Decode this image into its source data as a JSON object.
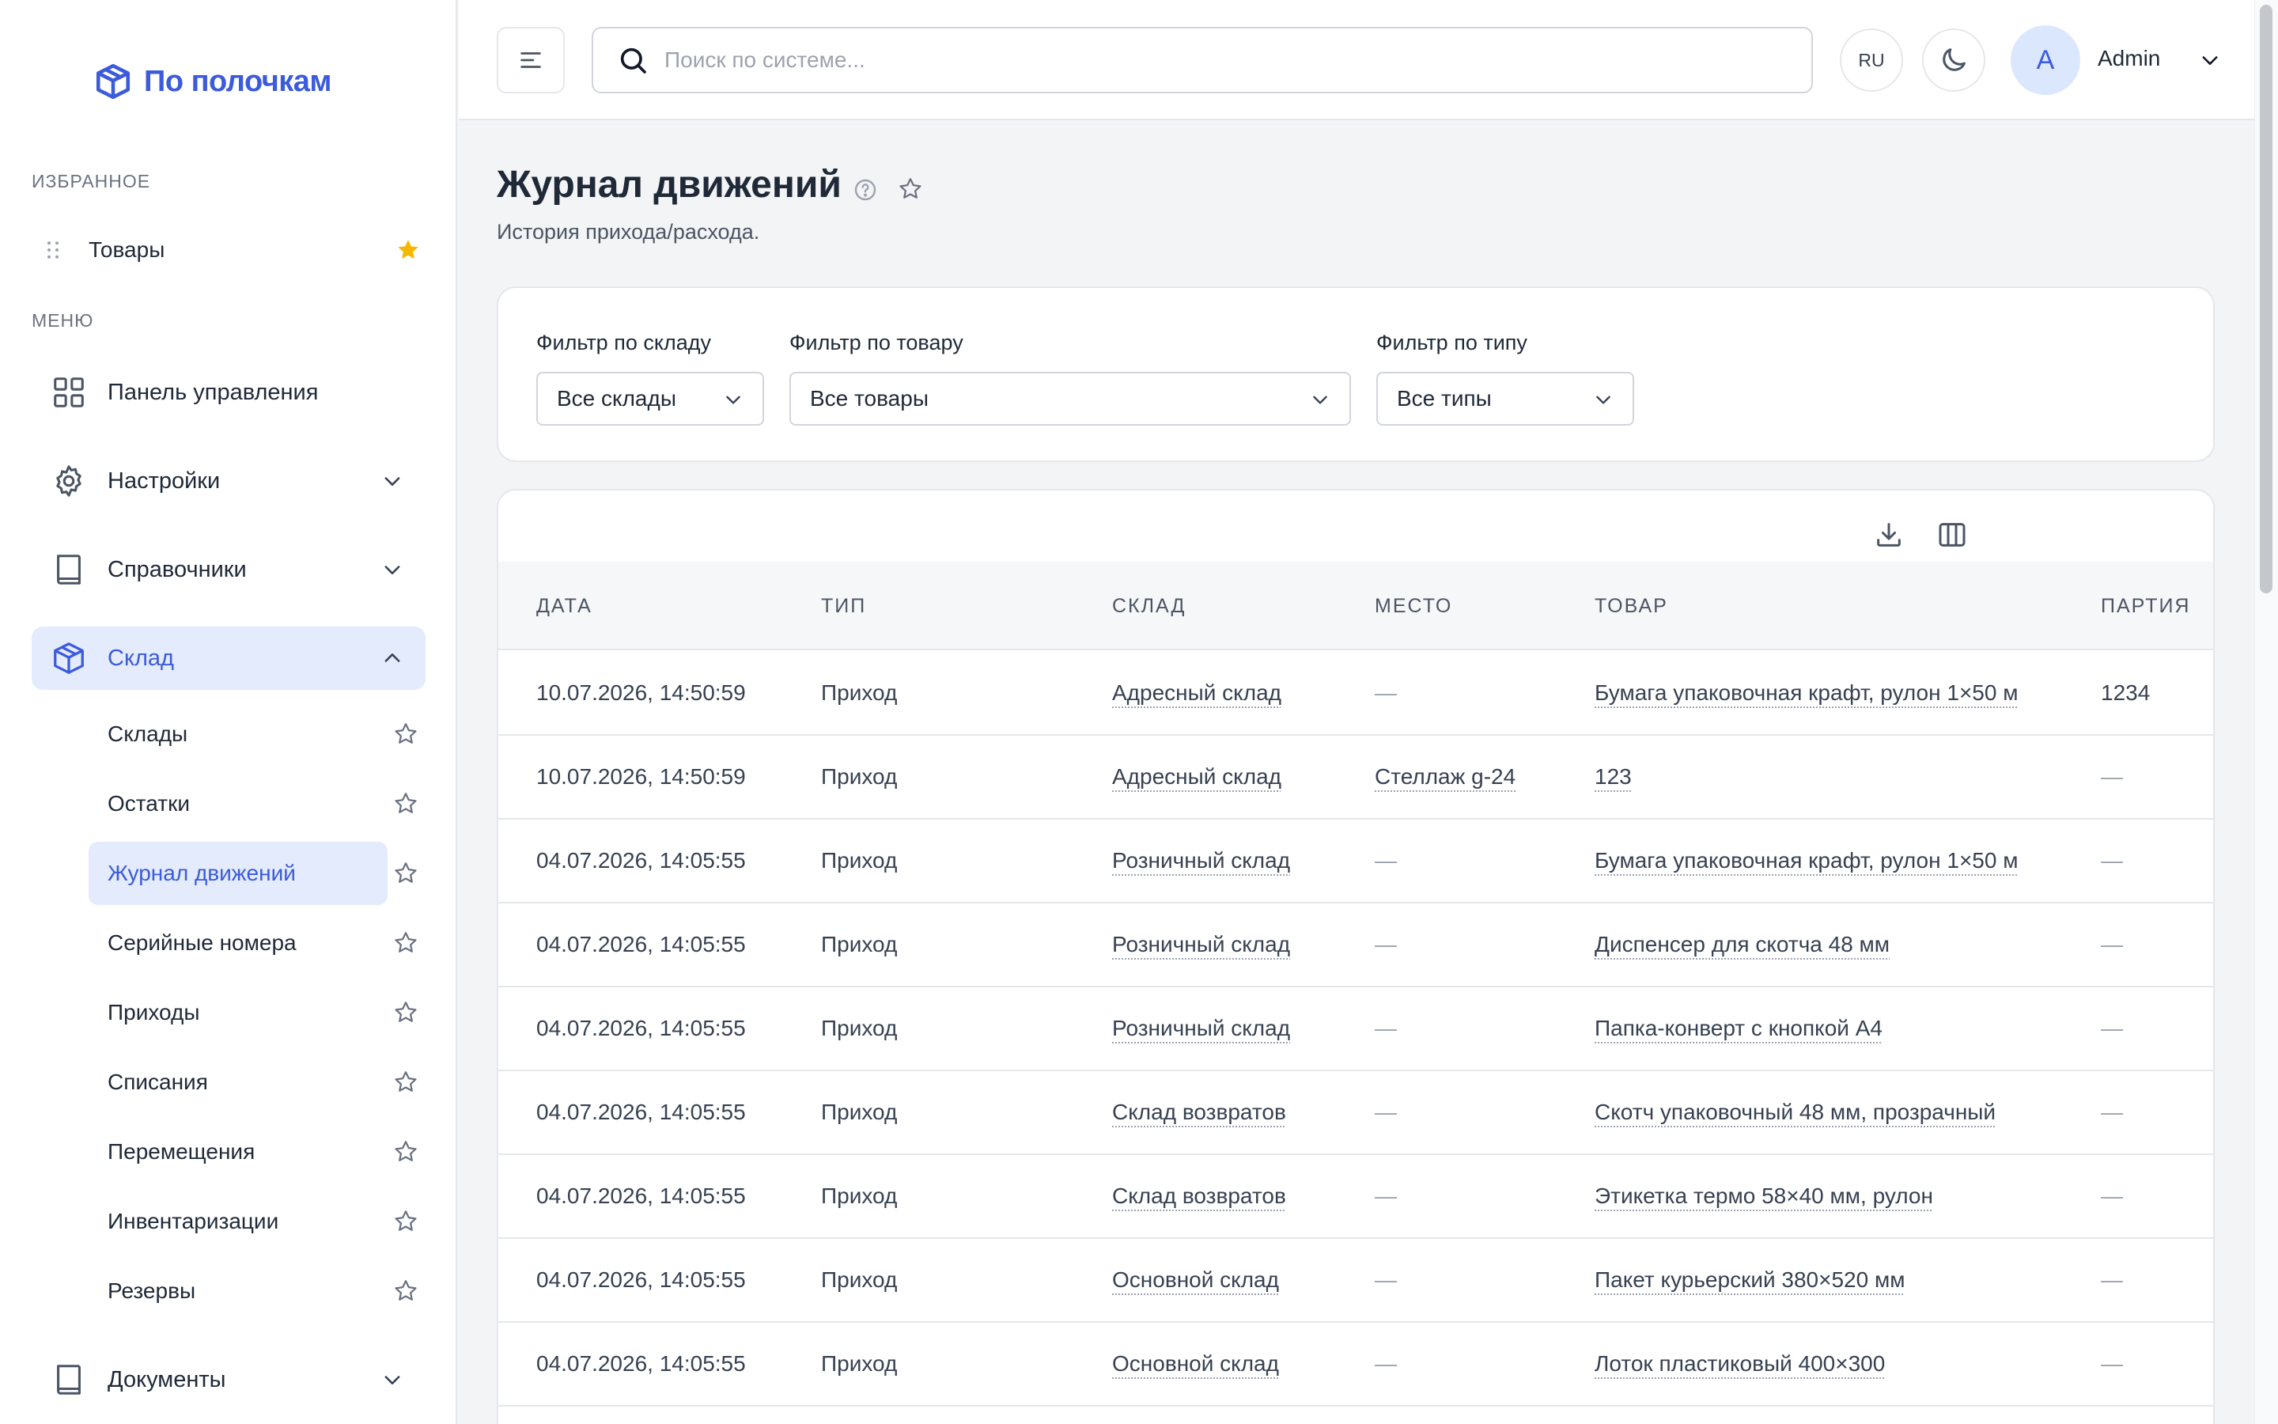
{
  "brand": {
    "name": "По полочкам"
  },
  "sidebar": {
    "favorites_label": "ИЗБРАННОЕ",
    "favorites": [
      {
        "label": "Товары",
        "icon": "star-filled-icon"
      }
    ],
    "menu_label": "МЕНЮ",
    "menu": [
      {
        "label": "Панель управления",
        "icon": "grid-icon"
      },
      {
        "label": "Настройки",
        "icon": "gear-icon"
      },
      {
        "label": "Справочники",
        "icon": "book-icon"
      },
      {
        "label": "Склад",
        "icon": "box-icon"
      },
      {
        "label": "Документы",
        "icon": "book-icon"
      }
    ],
    "warehouse_items": [
      {
        "label": "Склады"
      },
      {
        "label": "Остатки"
      },
      {
        "label": "Журнал движений"
      },
      {
        "label": "Серийные номера"
      },
      {
        "label": "Приходы"
      },
      {
        "label": "Списания"
      },
      {
        "label": "Перемещения"
      },
      {
        "label": "Инвентаризации"
      },
      {
        "label": "Резервы"
      }
    ]
  },
  "topbar": {
    "search_placeholder": "Поиск по системе...",
    "lang": "RU",
    "avatar_letter": "A",
    "user_name": "Admin"
  },
  "page": {
    "title": "Журнал движений",
    "subtitle": "История прихода/расхода."
  },
  "filters": [
    {
      "label": "Фильтр по складу",
      "value": "Все склады"
    },
    {
      "label": "Фильтр по товару",
      "value": "Все товары"
    },
    {
      "label": "Фильтр по типу",
      "value": "Все типы"
    }
  ],
  "table": {
    "columns": [
      "ДАТА",
      "ТИП",
      "СКЛАД",
      "МЕСТО",
      "ТОВАР",
      "ПАРТИЯ"
    ],
    "rows": [
      {
        "date": "10.07.2026, 14:50:59",
        "type": "Приход",
        "warehouse": "Адресный склад",
        "place": "—",
        "product": "Бумага упаковочная крафт, рулон 1×50 м",
        "batch": "1234"
      },
      {
        "date": "10.07.2026, 14:50:59",
        "type": "Приход",
        "warehouse": "Адресный склад",
        "place": "Стеллаж g-24",
        "product": "123",
        "batch": "—"
      },
      {
        "date": "04.07.2026, 14:05:55",
        "type": "Приход",
        "warehouse": "Розничный склад",
        "place": "—",
        "product": "Бумага упаковочная крафт, рулон 1×50 м",
        "batch": "—"
      },
      {
        "date": "04.07.2026, 14:05:55",
        "type": "Приход",
        "warehouse": "Розничный склад",
        "place": "—",
        "product": "Диспенсер для скотча 48 мм",
        "batch": "—"
      },
      {
        "date": "04.07.2026, 14:05:55",
        "type": "Приход",
        "warehouse": "Розничный склад",
        "place": "—",
        "product": "Папка-конверт с кнопкой А4",
        "batch": "—"
      },
      {
        "date": "04.07.2026, 14:05:55",
        "type": "Приход",
        "warehouse": "Склад возвратов",
        "place": "—",
        "product": "Скотч упаковочный 48 мм, прозрачный",
        "batch": "—"
      },
      {
        "date": "04.07.2026, 14:05:55",
        "type": "Приход",
        "warehouse": "Склад возвратов",
        "place": "—",
        "product": "Этикетка термо 58×40 мм, рулон",
        "batch": "—"
      },
      {
        "date": "04.07.2026, 14:05:55",
        "type": "Приход",
        "warehouse": "Основной склад",
        "place": "—",
        "product": "Пакет курьерский 380×520 мм",
        "batch": "—"
      },
      {
        "date": "04.07.2026, 14:05:55",
        "type": "Приход",
        "warehouse": "Основной склад",
        "place": "—",
        "product": "Лоток пластиковый 400×300",
        "batch": "—"
      }
    ]
  },
  "colors": {
    "accent": "#3b5bdb",
    "active_bg": "#e3ebfd",
    "favorite_star": "#f5b800"
  }
}
